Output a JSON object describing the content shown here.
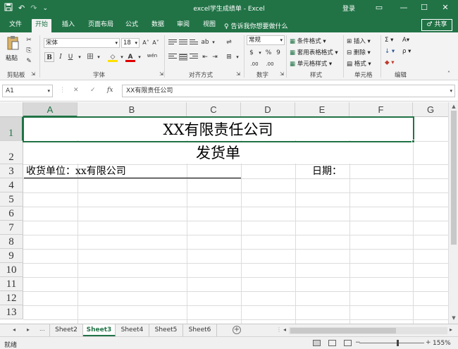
{
  "titlebar": {
    "qat_save_icon": "save-icon",
    "qat_undo": "↶",
    "qat_redo": "↷",
    "qat_more": "⌄",
    "window_title": "excel学生成绩单 - Excel",
    "login": "登录",
    "controls": [
      "▭",
      "—",
      "☐",
      "✕"
    ]
  },
  "ribbon_tabs": {
    "items": [
      "文件",
      "开始",
      "插入",
      "页面布局",
      "公式",
      "数据",
      "审阅",
      "视图"
    ],
    "active": "开始",
    "tell_me": "♀ 告诉我你想要做什么",
    "share": "♂ 共享"
  },
  "ribbon": {
    "clipboard": {
      "paste_label": "粘贴",
      "group_label": "剪贴板"
    },
    "font": {
      "font_name": "宋体",
      "font_size": "18",
      "grow": "A˄",
      "shrink": "A˅",
      "bold": "B",
      "italic": "I",
      "underline": "U",
      "border_btn": "田",
      "fill_btn": "◇",
      "color_btn": "A",
      "wen_btn": "wén",
      "group_label": "字体"
    },
    "alignment": {
      "group_label": "对齐方式"
    },
    "number": {
      "format": "常规",
      "currency": "$",
      "percent": "%",
      "comma": "9",
      "inc_dec": ".00",
      "group_label": "数字"
    },
    "styles": {
      "items": [
        "条件格式 ▾",
        "套用表格格式 ▾",
        "单元格样式 ▾"
      ],
      "group_label": "样式"
    },
    "cells": {
      "items": [
        "插入 ▾",
        "删除 ▾",
        "格式 ▾"
      ],
      "group_label": "单元格"
    },
    "editing": {
      "items": [
        "Σ ▾",
        "↓ ▾",
        "◆ ▾"
      ],
      "extra": [
        "A▾",
        "ρ ▾"
      ],
      "group_label": "编辑"
    }
  },
  "formula_bar": {
    "name_box": "A1",
    "cancel": "✕",
    "enter": "✓",
    "fx": "fx",
    "formula": "XX有限责任公司"
  },
  "grid": {
    "columns": [
      "A",
      "B",
      "C",
      "D",
      "E",
      "F",
      "G"
    ],
    "selected_column": "A",
    "rows": [
      "1",
      "2",
      "3",
      "4",
      "5",
      "6",
      "7",
      "8",
      "9",
      "10",
      "11",
      "12",
      "13"
    ],
    "selected_row": "1",
    "cells": {
      "title": "XX有限责任公司",
      "subtitle": "发货单",
      "receiver": "收货单位：xx有限公司",
      "date": "日期："
    }
  },
  "sheets": {
    "nav": [
      "◂",
      "▸",
      "..."
    ],
    "tabs": [
      "Sheet2",
      "Sheet3",
      "Sheet4",
      "Sheet5",
      "Sheet6"
    ],
    "active": "Sheet3",
    "add": "+"
  },
  "statusbar": {
    "status": "就绪",
    "zoom_minus": "−",
    "zoom_plus": "+",
    "zoom": "155%"
  },
  "colors": {
    "accent": "#217346",
    "ribbon_bg": "#f3f3f3",
    "grid_line": "#dcdcdc"
  }
}
